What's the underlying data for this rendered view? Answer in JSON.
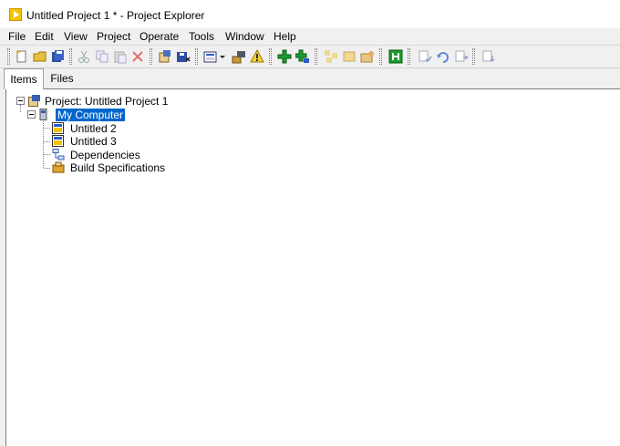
{
  "window": {
    "title": "Untitled Project 1 * - Project Explorer"
  },
  "menu": [
    "File",
    "Edit",
    "View",
    "Project",
    "Operate",
    "Tools",
    "Window",
    "Help"
  ],
  "tabs": {
    "items": "Items",
    "files": "Files"
  },
  "tree": {
    "project": "Project: Untitled Project 1",
    "my_computer": "My Computer",
    "children": [
      "Untitled 2",
      "Untitled 3",
      "Dependencies",
      "Build Specifications"
    ]
  }
}
